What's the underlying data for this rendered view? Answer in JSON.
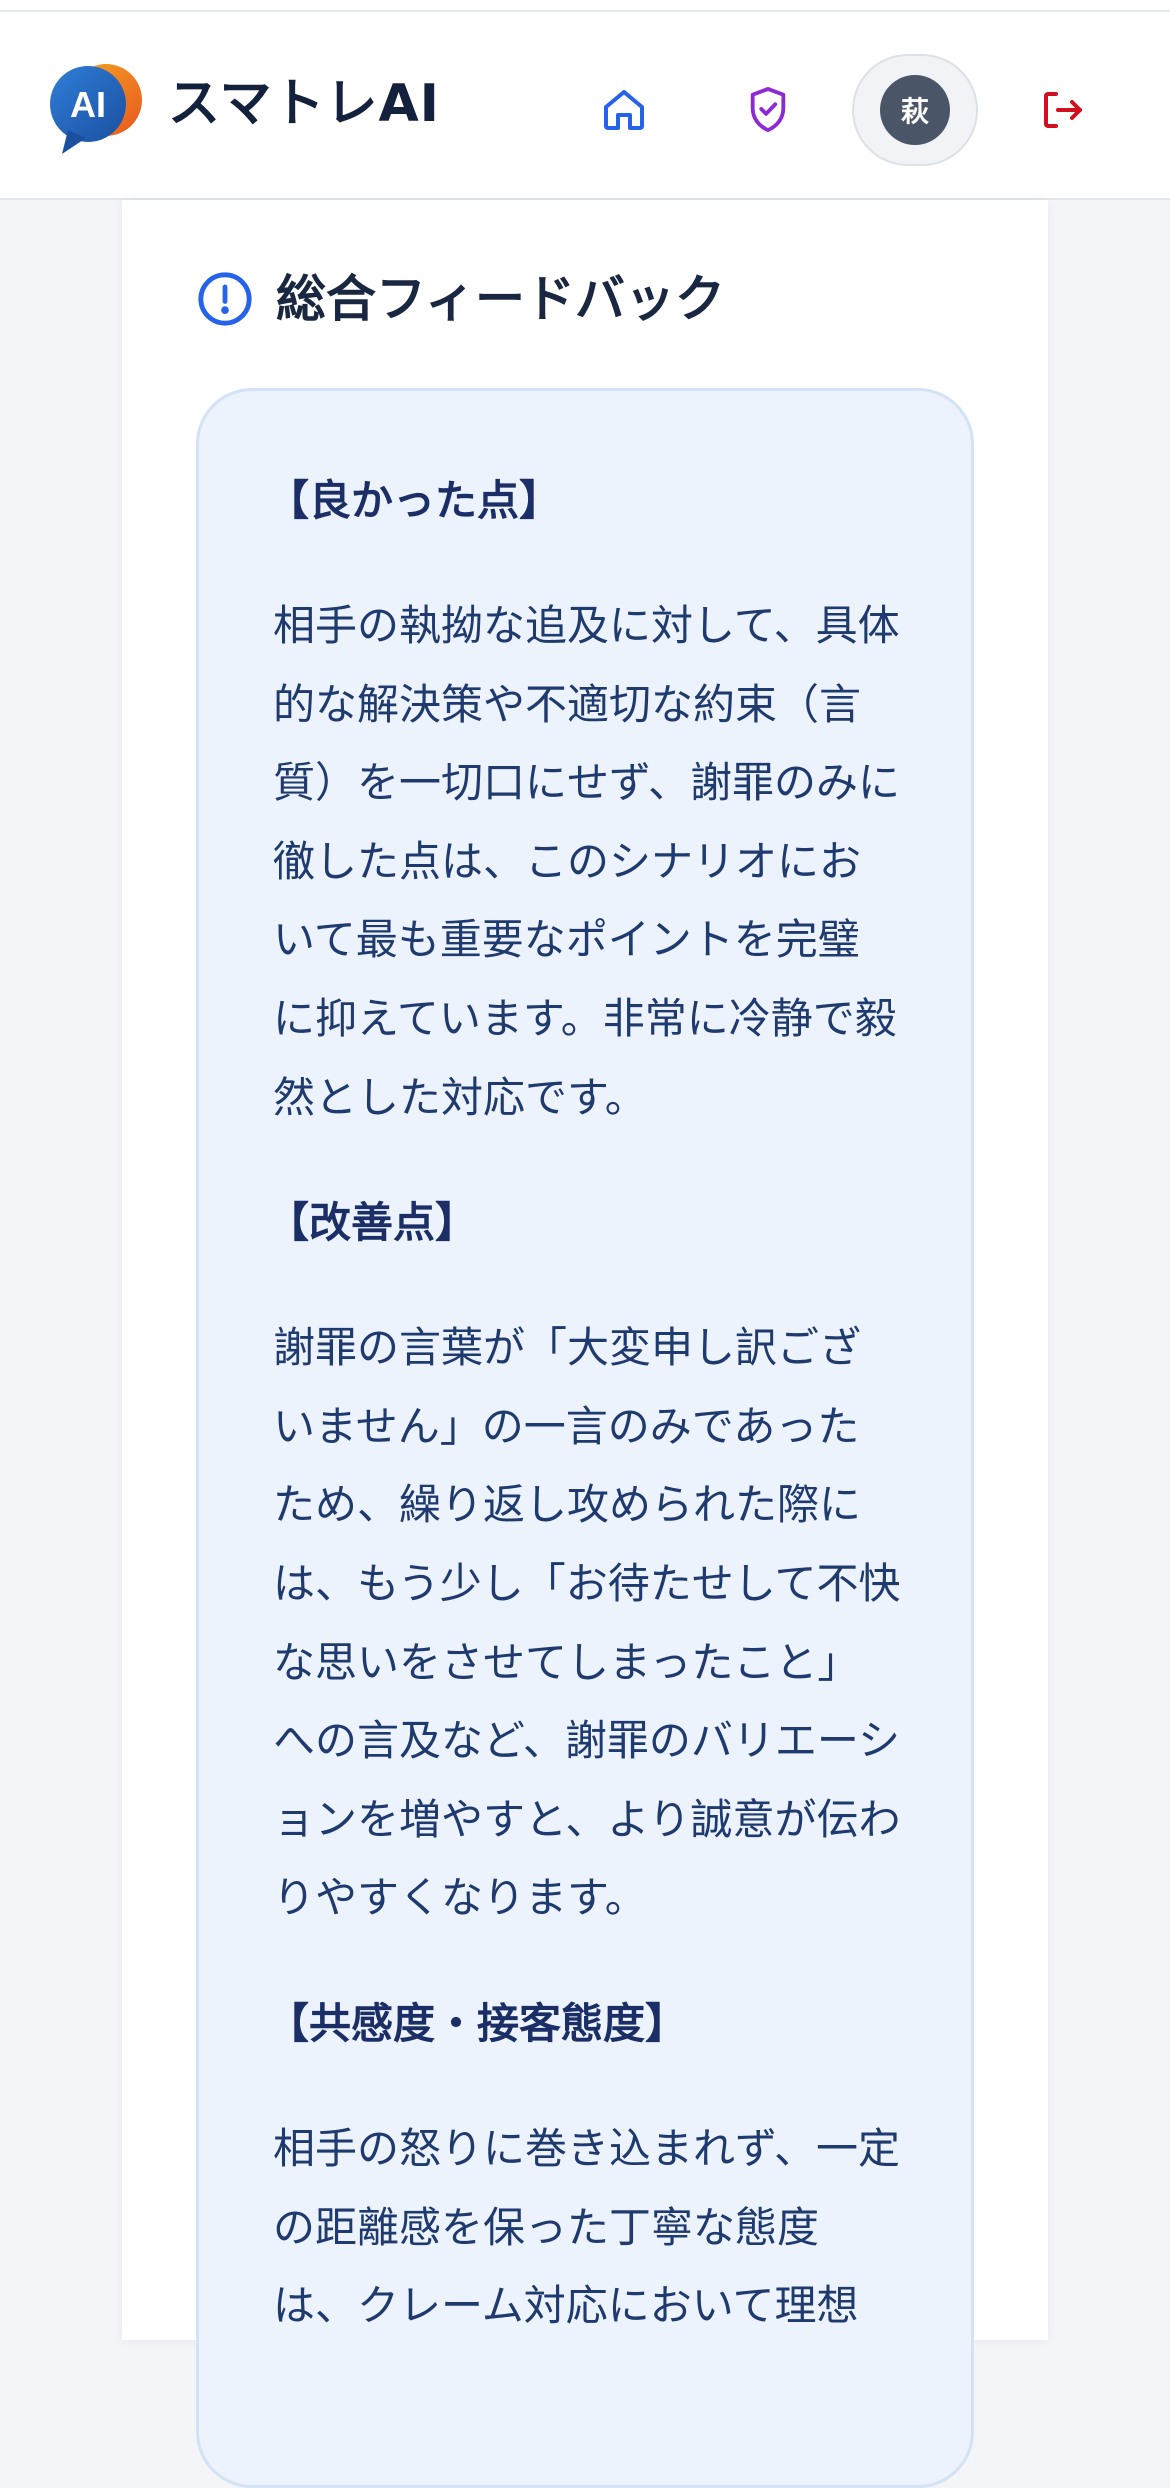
{
  "header": {
    "brand": "スマトレAI",
    "logo_text": "AI",
    "avatar_initial": "萩",
    "icons": {
      "home": "home-icon",
      "shield": "shield-check-icon",
      "logout": "logout-icon"
    }
  },
  "feedback": {
    "title": "総合フィードバック",
    "title_icon": "info-circle-icon",
    "sections": [
      {
        "heading": "【良かった点】",
        "body": "相手の執拗な追及に対して、具体的な解決策や不適切な約束（言質）を一切口にせず、謝罪のみに徹した点は、このシナリオにおいて最も重要なポイントを完璧に抑えています。非常に冷静で毅然とした対応です。"
      },
      {
        "heading": "【改善点】",
        "body": "謝罪の言葉が「大変申し訳ございません」の一言のみであったため、繰り返し攻められた際には、もう少し「お待たせして不快な思いをさせてしまったこと」への言及など、謝罪のバリエーションを増やすと、より誠意が伝わりやすくなります。"
      },
      {
        "heading": "【共感度・接客態度】",
        "body": "相手の怒りに巻き込まれず、一定の距離感を保った丁寧な態度は、クレーム対応において理想"
      }
    ]
  },
  "colors": {
    "accent_blue": "#2563eb",
    "shield_purple": "#8b2ad6",
    "logout_red": "#d0101f",
    "feedback_bg": "#edf3fc",
    "text_navy": "#1f3a6e"
  }
}
